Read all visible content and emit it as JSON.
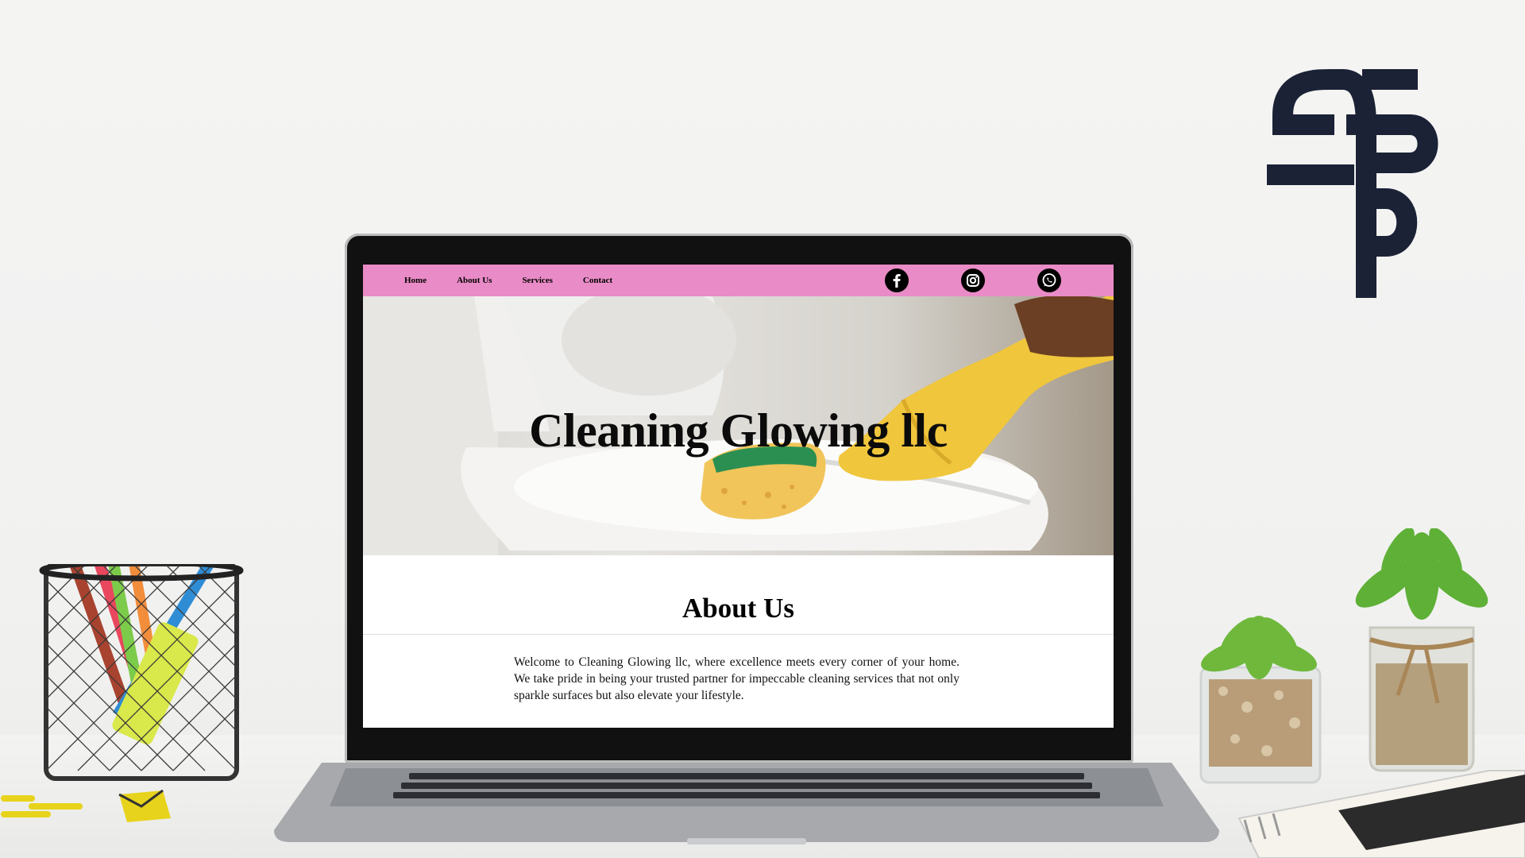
{
  "site": {
    "nav": {
      "items": [
        "Home",
        "About Us",
        "Services",
        "Contact"
      ]
    },
    "social": [
      "facebook-icon",
      "instagram-icon",
      "whatsapp-icon"
    ],
    "hero": {
      "title": "Cleaning Glowing llc"
    },
    "about": {
      "title": "About Us",
      "text": "Welcome to Cleaning Glowing llc, where excellence meets every corner of your home. We take pride in being your trusted partner for impeccable cleaning services that not only sparkle surfaces but also elevate your lifestyle."
    }
  },
  "colors": {
    "nav_bg": "#e98bc6",
    "logo": "#1b2236",
    "glove": "#f2c63a"
  }
}
